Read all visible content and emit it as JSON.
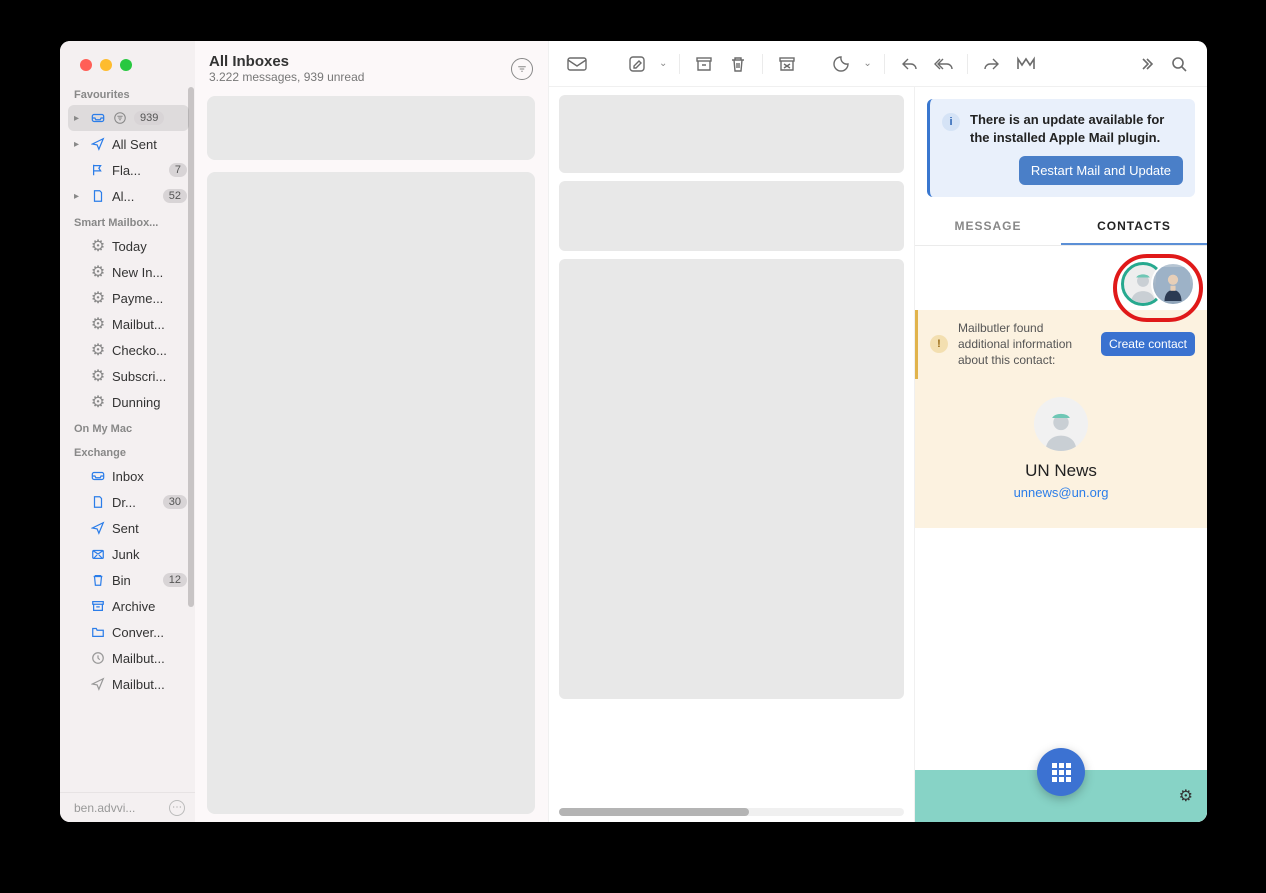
{
  "header": {
    "title": "All Inboxes",
    "subtitle": "3.222 messages, 939 unread"
  },
  "sidebar": {
    "sections": [
      {
        "title": "Favourites",
        "items": [
          {
            "label": "",
            "badge": "939",
            "icon": "inbox",
            "sel": true,
            "expand": true,
            "extra": true
          },
          {
            "label": "All Sent",
            "icon": "send",
            "expand": true
          },
          {
            "label": "Fla...",
            "icon": "flag",
            "badge": "7"
          },
          {
            "label": "Al...",
            "icon": "doc",
            "badge": "52",
            "expand": true
          }
        ]
      },
      {
        "title": "Smart Mailbox...",
        "items": [
          {
            "label": "Today",
            "icon": "gear"
          },
          {
            "label": "New In...",
            "icon": "gear"
          },
          {
            "label": "Payme...",
            "icon": "gear"
          },
          {
            "label": "Mailbut...",
            "icon": "gear"
          },
          {
            "label": "Checko...",
            "icon": "gear"
          },
          {
            "label": "Subscri...",
            "icon": "gear"
          },
          {
            "label": "Dunning",
            "icon": "gear"
          }
        ]
      },
      {
        "title": "On My Mac",
        "items": []
      },
      {
        "title": "Exchange",
        "items": [
          {
            "label": "Inbox",
            "icon": "inbox"
          },
          {
            "label": "Dr...",
            "icon": "doc",
            "badge": "30"
          },
          {
            "label": "Sent",
            "icon": "send"
          },
          {
            "label": "Junk",
            "icon": "junk"
          },
          {
            "label": "Bin",
            "icon": "trash",
            "badge": "12"
          },
          {
            "label": "Archive",
            "icon": "archive"
          },
          {
            "label": "Conver...",
            "icon": "folder"
          },
          {
            "label": "Mailbut...",
            "icon": "clock"
          },
          {
            "label": "Mailbut...",
            "icon": "sent2"
          }
        ]
      }
    ],
    "footer": "ben.advvi..."
  },
  "update_banner": {
    "text": "There is an update available for the installed Apple Mail plugin.",
    "button": "Restart Mail and Update"
  },
  "tabs": {
    "message": "MESSAGE",
    "contacts": "CONTACTS"
  },
  "contact_strip": {
    "text": "Mailbutler found additional information about this contact:",
    "button": "Create contact"
  },
  "contact_card": {
    "name": "UN News",
    "email": "unnews@un.org"
  }
}
